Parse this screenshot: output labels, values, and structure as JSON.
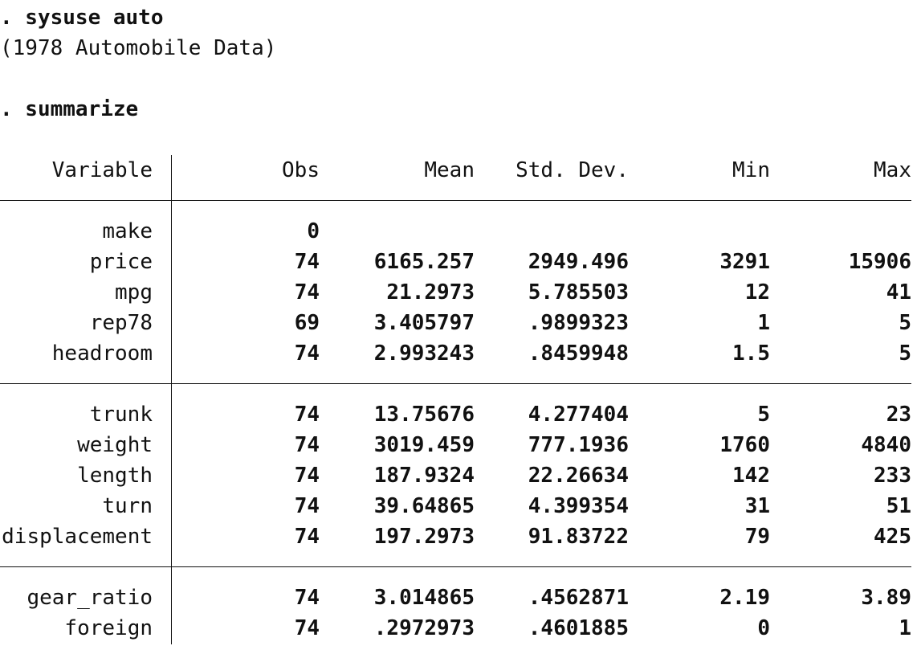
{
  "console": {
    "cmd1": ". sysuse auto",
    "output1": "(1978 Automobile Data)",
    "cmd2": ". summarize"
  },
  "table": {
    "headers": [
      "Variable",
      "Obs",
      "Mean",
      "Std. Dev.",
      "Min",
      "Max"
    ],
    "groups": [
      [
        {
          "variable": "make",
          "obs": "0",
          "mean": "",
          "sd": "",
          "min": "",
          "max": ""
        },
        {
          "variable": "price",
          "obs": "74",
          "mean": "6165.257",
          "sd": "2949.496",
          "min": "3291",
          "max": "15906"
        },
        {
          "variable": "mpg",
          "obs": "74",
          "mean": "21.2973",
          "sd": "5.785503",
          "min": "12",
          "max": "41"
        },
        {
          "variable": "rep78",
          "obs": "69",
          "mean": "3.405797",
          "sd": ".9899323",
          "min": "1",
          "max": "5"
        },
        {
          "variable": "headroom",
          "obs": "74",
          "mean": "2.993243",
          "sd": ".8459948",
          "min": "1.5",
          "max": "5"
        }
      ],
      [
        {
          "variable": "trunk",
          "obs": "74",
          "mean": "13.75676",
          "sd": "4.277404",
          "min": "5",
          "max": "23"
        },
        {
          "variable": "weight",
          "obs": "74",
          "mean": "3019.459",
          "sd": "777.1936",
          "min": "1760",
          "max": "4840"
        },
        {
          "variable": "length",
          "obs": "74",
          "mean": "187.9324",
          "sd": "22.26634",
          "min": "142",
          "max": "233"
        },
        {
          "variable": "turn",
          "obs": "74",
          "mean": "39.64865",
          "sd": "4.399354",
          "min": "31",
          "max": "51"
        },
        {
          "variable": "displacement",
          "obs": "74",
          "mean": "197.2973",
          "sd": "91.83722",
          "min": "79",
          "max": "425"
        }
      ],
      [
        {
          "variable": "gear_ratio",
          "obs": "74",
          "mean": "3.014865",
          "sd": ".4562871",
          "min": "2.19",
          "max": "3.89"
        },
        {
          "variable": "foreign",
          "obs": "74",
          "mean": ".2972973",
          "sd": ".4601885",
          "min": "0",
          "max": "1"
        }
      ]
    ]
  }
}
